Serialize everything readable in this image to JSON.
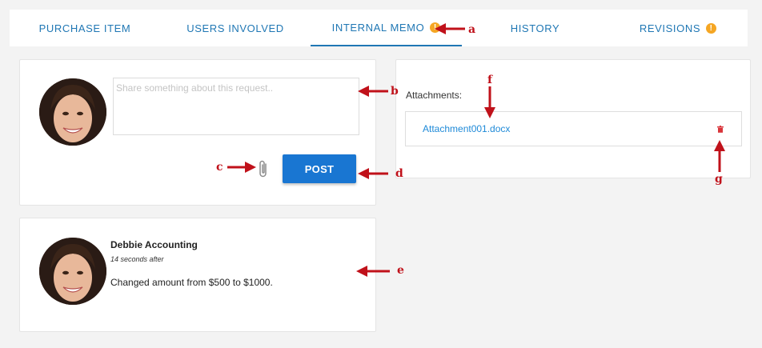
{
  "tabs": [
    {
      "label": "PURCHASE ITEM",
      "active": false,
      "badge": ""
    },
    {
      "label": "USERS INVOLVED",
      "active": false,
      "badge": ""
    },
    {
      "label": "INTERNAL MEMO",
      "active": true,
      "badge": "!"
    },
    {
      "label": "HISTORY",
      "active": false,
      "badge": ""
    },
    {
      "label": "REVISIONS",
      "active": false,
      "badge": "!"
    }
  ],
  "memo": {
    "placeholder": "Share something about this request..",
    "post_label": "POST"
  },
  "attachments": {
    "label": "Attachments:",
    "items": [
      {
        "name": "Attachment001.docx"
      }
    ]
  },
  "comment": {
    "author": "Debbie Accounting",
    "time": "14 seconds after",
    "text": "Changed amount from $500 to $1000."
  },
  "annotations": {
    "a": "a",
    "b": "b",
    "c": "c",
    "d": "d",
    "e": "e",
    "f": "f",
    "g": "g"
  },
  "colors": {
    "accent": "#1f77b4",
    "button": "#1976d2",
    "badge": "#f5a623",
    "annotation": "#c0111a",
    "delete": "#d9343a"
  }
}
